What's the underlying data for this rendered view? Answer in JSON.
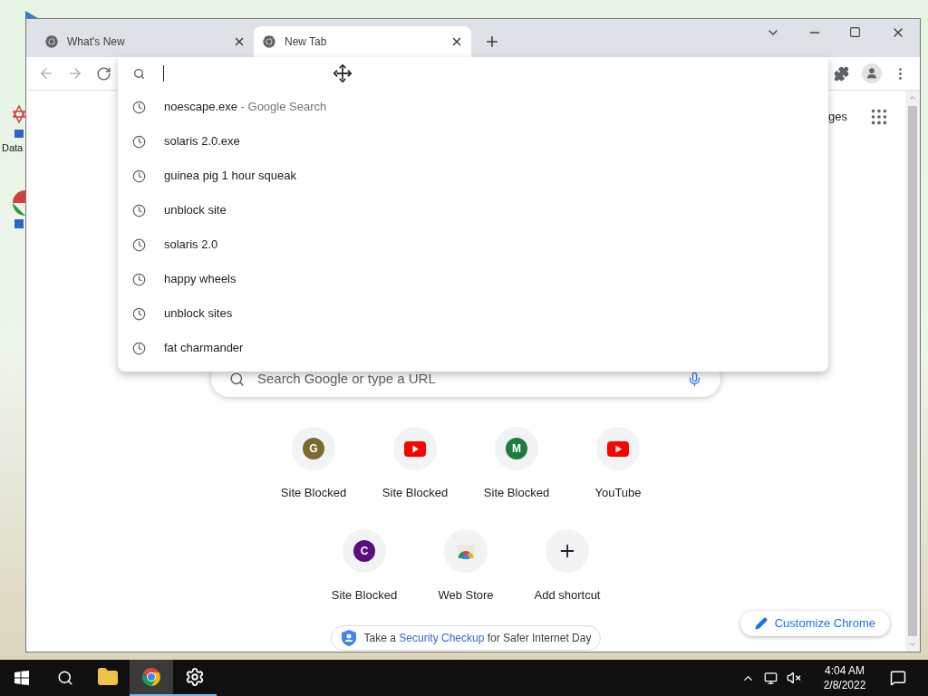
{
  "desktop": {
    "icons": [
      {
        "label": "Data"
      }
    ]
  },
  "tabs": [
    {
      "title": "What's New",
      "selected": false
    },
    {
      "title": "New Tab",
      "selected": true
    }
  ],
  "suggestions": [
    {
      "text": "noescape.exe",
      "suffix": "- Google Search"
    },
    {
      "text": "solaris 2.0.exe"
    },
    {
      "text": "guinea pig 1 hour squeak"
    },
    {
      "text": "unblock site"
    },
    {
      "text": "solaris 2.0"
    },
    {
      "text": "happy wheels"
    },
    {
      "text": "unblock sites"
    },
    {
      "text": "fat charmander"
    }
  ],
  "images_link_visible": "ges",
  "search": {
    "placeholder": "Search Google or type a URL"
  },
  "shortcuts": [
    {
      "label": "Site Blocked",
      "kind": "letter",
      "letter": "G",
      "color": "#7b6b2e"
    },
    {
      "label": "Site Blocked",
      "kind": "youtube"
    },
    {
      "label": "Site Blocked",
      "kind": "letter",
      "letter": "M",
      "color": "#1e7d3c"
    },
    {
      "label": "YouTube",
      "kind": "youtube"
    },
    {
      "label": "Site Blocked",
      "kind": "letter",
      "letter": "C",
      "color": "#5a0f7d"
    },
    {
      "label": "Web Store",
      "kind": "webstore"
    },
    {
      "label": "Add shortcut",
      "kind": "add"
    }
  ],
  "promo": {
    "before": "Take a",
    "link": "Security Checkup",
    "after": "for Safer Internet Day"
  },
  "customize": "Customize Chrome",
  "taskbar": {
    "apps": [
      {
        "kind": "explorer",
        "selected": false,
        "running": false
      },
      {
        "kind": "chrome",
        "selected": true,
        "running": true
      },
      {
        "kind": "settings",
        "selected": false,
        "running": true
      }
    ],
    "time": "4:04 AM",
    "date": "2/8/2022"
  }
}
